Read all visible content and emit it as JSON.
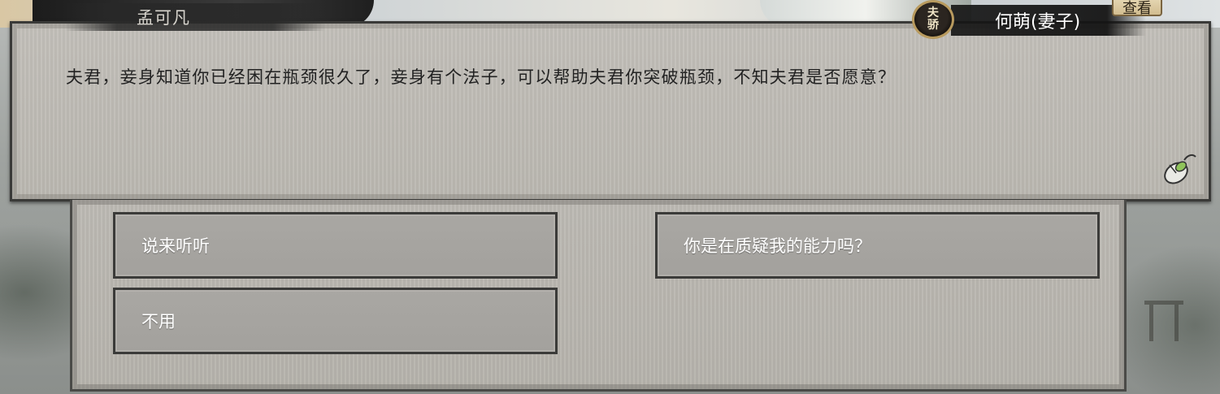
{
  "speaker": {
    "name": "孟可凡"
  },
  "listener": {
    "name": "何萌(妻子)",
    "emblem_line1": "夫",
    "emblem_line2": "骄",
    "view_label": "查看"
  },
  "dialogue": {
    "text": "夫君，妾身知道你已经困在瓶颈很久了，妾身有个法子，可以帮助夫君你突破瓶颈，不知夫君是否愿意？"
  },
  "choices": [
    {
      "label": "说来听听"
    },
    {
      "label": "你是在质疑我的能力吗？"
    },
    {
      "label": "不用"
    }
  ],
  "icons": {
    "continue": "mouse-icon",
    "emblem": "relationship-emblem-icon"
  },
  "colors": {
    "panel": "#bbb8b1",
    "choice_bg": "#a9a7a3",
    "border": "#3a3a38",
    "emblem_ring": "#b89a5e"
  }
}
